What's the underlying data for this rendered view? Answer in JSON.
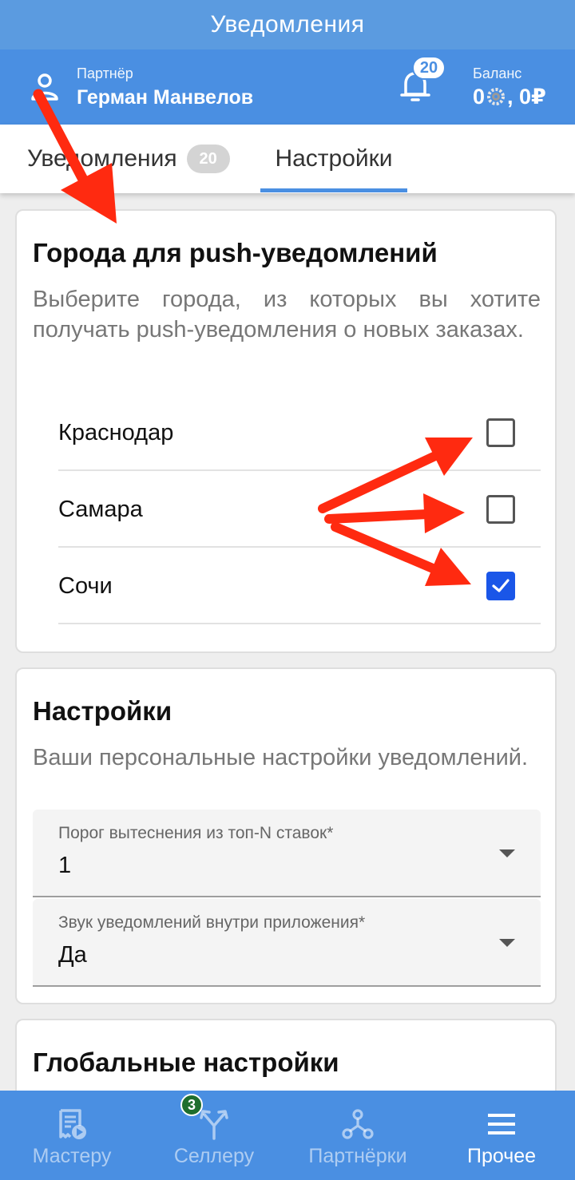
{
  "status_bar": {
    "title": "Уведомления"
  },
  "header": {
    "partner_label": "Партнёр",
    "partner_name": "Герман Манвелов",
    "notification_count": "20",
    "balance_label": "Баланс",
    "balance_prefix": "0",
    "balance_suffix": ", 0₽"
  },
  "tabs": [
    {
      "label": "Уведомления",
      "badge": "20",
      "active": false
    },
    {
      "label": "Настройки",
      "active": true
    }
  ],
  "cities_card": {
    "title": "Города для push-уведомлений",
    "description": "Выберите города, из которых вы хотите получать push-уведомления о новых заказах.",
    "cities": [
      {
        "name": "Краснодар",
        "checked": false
      },
      {
        "name": "Самара",
        "checked": false
      },
      {
        "name": "Сочи",
        "checked": true
      }
    ]
  },
  "settings_card": {
    "title": "Настройки",
    "description": "Ваши персональные настройки уведомлений.",
    "fields": [
      {
        "label": "Порог вытеснения из топ-N ставок*",
        "value": "1"
      },
      {
        "label": "Звук уведомлений внутри приложения*",
        "value": "Да"
      }
    ]
  },
  "global_card": {
    "title": "Глобальные настройки"
  },
  "bottom_nav": [
    {
      "label": "Мастеру",
      "icon": "receipt-play-icon",
      "active": false
    },
    {
      "label": "Селлеру",
      "icon": "fork-arrows-icon",
      "badge": "3",
      "active": false
    },
    {
      "label": "Партнёрки",
      "icon": "network-icon",
      "active": false
    },
    {
      "label": "Прочее",
      "icon": "menu-icon",
      "active": true
    }
  ],
  "colors": {
    "primary": "#4a8fe2",
    "checkbox_checked": "#1a56e8",
    "annotation_arrow": "#ff2a10",
    "badge_green": "#1f6e2d"
  }
}
